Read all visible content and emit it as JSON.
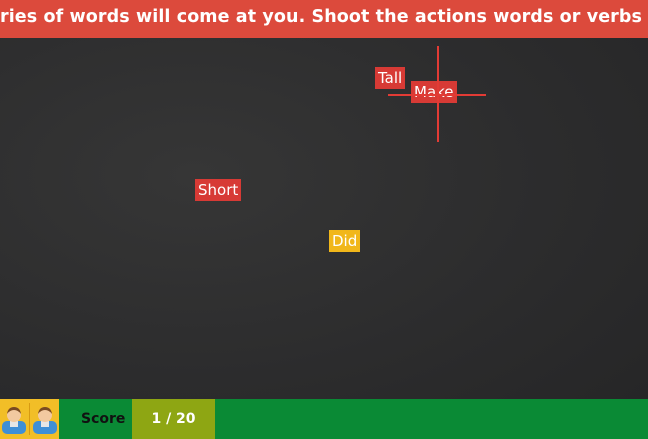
{
  "instruction": "eries of words will come at you. Shoot the actions words or verbs at sig",
  "words": {
    "tall": "Tall",
    "make": "Make",
    "short": "Short",
    "did": "Did"
  },
  "score": {
    "label": "Score",
    "value": "1 / 20"
  },
  "icons": {
    "crosshair": "crosshair-icon",
    "player": "user-icon"
  },
  "colors": {
    "instruction_bar": "#dc4a3c",
    "word_red": "#d73a35",
    "word_yellow": "#f1b71a",
    "bottom_bar": "#0a8a35",
    "score_box": "#8ea613",
    "players_panel": "#f2be27"
  }
}
